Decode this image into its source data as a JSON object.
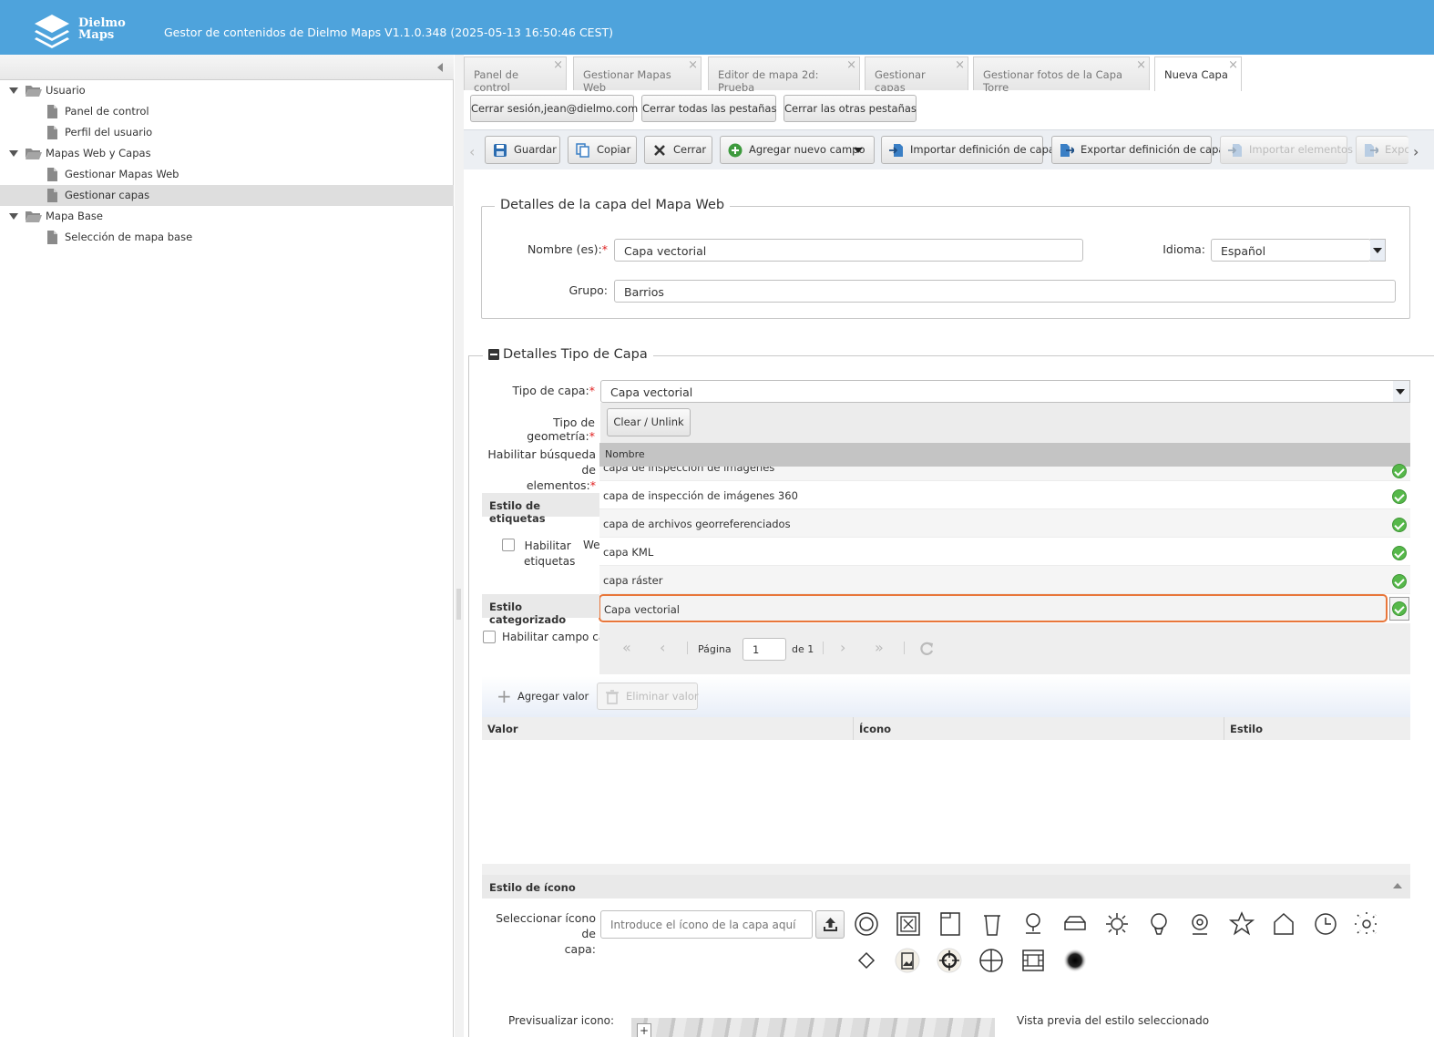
{
  "header": {
    "brand_line1": "Dielmo",
    "brand_line2": "Maps",
    "title": "Gestor de contenidos de Dielmo Maps V1.1.0.348 (2025-05-13 16:50:46 CEST)"
  },
  "sidebar": {
    "items": [
      {
        "label": "Usuario",
        "type": "folder"
      },
      {
        "label": "Panel de control",
        "type": "doc"
      },
      {
        "label": "Perfil del usuario",
        "type": "doc"
      },
      {
        "label": "Mapas Web y Capas",
        "type": "folder"
      },
      {
        "label": "Gestionar Mapas Web",
        "type": "doc"
      },
      {
        "label": "Gestionar capas",
        "type": "doc",
        "selected": true
      },
      {
        "label": "Mapa Base",
        "type": "folder"
      },
      {
        "label": "Selección de mapa base",
        "type": "doc"
      }
    ]
  },
  "tabs": [
    {
      "label": "Panel de control"
    },
    {
      "label": "Gestionar Mapas Web"
    },
    {
      "label": "Editor de mapa 2d: Prueba"
    },
    {
      "label": "Gestionar capas"
    },
    {
      "label": "Gestionar fotos de la Capa Torre"
    },
    {
      "label": "Nueva Capa",
      "active": true
    }
  ],
  "session_buttons": {
    "logout": "Cerrar sesión,jean@dielmo.com",
    "close_all": "Cerrar todas las pestañas",
    "close_others": "Cerrar las otras pestañas"
  },
  "toolbar": {
    "save": "Guardar",
    "copy": "Copiar",
    "close": "Cerrar",
    "add_field": "Agregar nuevo campo",
    "import_def": "Importar definición de capa",
    "export_def": "Exportar definición de capa",
    "import_elements": "Importar elementos",
    "export_partial": "Expo"
  },
  "details": {
    "legend": "Detalles de la capa del Mapa Web",
    "name_label": "Nombre (es):",
    "name_value": "Capa vectorial",
    "lang_label": "Idioma:",
    "lang_value": "Español",
    "group_label": "Grupo:",
    "group_value": "Barrios"
  },
  "type_details": {
    "legend": "Detalles Tipo de Capa",
    "type_label": "Tipo de capa:",
    "type_value": "Capa vectorial",
    "geom_label": "Tipo de geometría:",
    "clear_button": "Clear / Unlink",
    "search_label_1": "Habilitar búsqueda de",
    "search_label_2": "elementos:",
    "labels_section": "Estilo de etiquetas",
    "enable_labels_1": "Habilitar",
    "enable_labels_2": "etiquetas",
    "partial_we": "We",
    "categorized_section": "Estilo categorizado",
    "enable_category": "Habilitar campo cate"
  },
  "dropdown": {
    "header": "Nombre",
    "options": [
      {
        "label": "capa de inspección de imágenes"
      },
      {
        "label": "capa de inspección de imágenes 360"
      },
      {
        "label": "capa de archivos georreferenciados"
      },
      {
        "label": "capa KML"
      },
      {
        "label": "capa ráster"
      },
      {
        "label": "Capa vectorial",
        "selected": true
      }
    ],
    "pager": {
      "page_label": "Página",
      "page_value": "1",
      "of_label": "de 1"
    }
  },
  "values_grid": {
    "add": "Agregar valor",
    "remove": "Eliminar valor",
    "columns": [
      "Valor",
      "Ícono",
      "Estilo"
    ]
  },
  "icon_style": {
    "section": "Estilo de ícono",
    "select_label_1": "Seleccionar ícono de",
    "select_label_2": "capa:",
    "placeholder": "Introduce el ícono de la capa aquí",
    "icons": [
      "circle-target-icon",
      "boxed-x-icon",
      "document-icon",
      "trash-bin-icon",
      "pin-icon",
      "open-box-icon",
      "sun-icon",
      "balloon-icon",
      "webcam-icon",
      "star-icon",
      "house-icon",
      "clock-icon",
      "dotted-sun-icon",
      "diamond-icon",
      "photo-icon",
      "crosshair-icon",
      "circle-cross-icon",
      "film-frame-icon",
      "blur-dot-icon"
    ]
  },
  "preview": {
    "label": "Previsualizar icono:",
    "style_preview": "Vista previa del estilo seleccionado"
  },
  "colors": {
    "header": "#4ea3dc",
    "accent_highlight": "#e8763a",
    "success": "#56b84a",
    "required": "#e02020"
  }
}
